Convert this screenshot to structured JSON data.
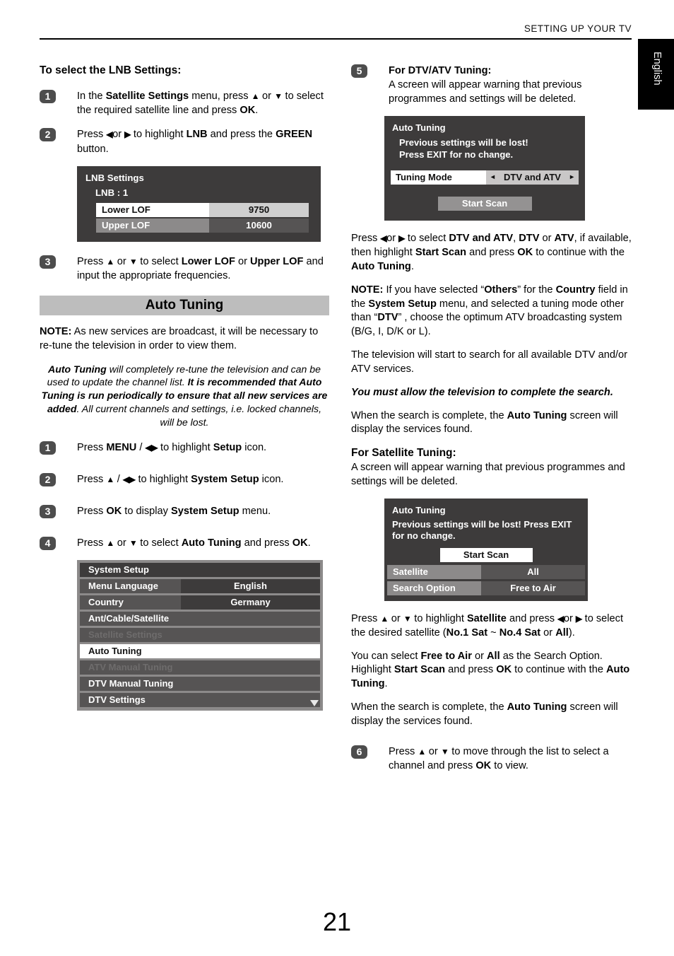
{
  "header": {
    "title": "SETTING UP YOUR TV",
    "language_tab": "English"
  },
  "page_number": "21",
  "left_column": {
    "heading": "To select the LNB Settings:",
    "steps": [
      {
        "number": "1",
        "text_html": "In the <b>Satellite Settings</b> menu, press <b class=\"arrow\">▲</b> or <b class=\"arrow\">▼</b> to select the required satellite line and press <b>OK</b>."
      },
      {
        "number": "2",
        "text_html": "Press <b class=\"arrow\">◀</b>or <b class=\"arrow\">▶</b> to highlight <b>LNB</b> and press the <b>GREEN</b> button."
      },
      {
        "number": "3",
        "text_html": "Press <b class=\"arrow\">▲</b> or <b class=\"arrow\">▼</b> to select <b>Lower LOF</b> or <b>Upper LOF</b> and input the appropriate frequencies."
      }
    ],
    "lnb_osd": {
      "title": "LNB Settings",
      "subtitle": "LNB : 1",
      "rows": [
        {
          "label": "Lower LOF",
          "value": "9750",
          "state": "selected"
        },
        {
          "label": "Upper LOF",
          "value": "10600",
          "state": "normal"
        }
      ]
    },
    "section_banner": "Auto Tuning",
    "note_html": "<b>NOTE:</b> As new services are broadcast, it will be necessary to re-tune the television in order to view them.",
    "italic_note_html": "<span class=\"i-strong\">Auto Tuning</span> <span class=\"i-norm\">will completely re-tune the television and can be used to update the channel list.</span> <span class=\"i-strong\">It is recommended that Auto Tuning is run periodically to ensure that all new services are added</span><span class=\"i-norm\">. All current channels and settings, i.e. locked channels, will be lost.</span>",
    "auto_tuning_steps": [
      {
        "number": "1",
        "text_html": "Press <b>MENU</b> / <b class=\"arrow\">◀▶</b> to highlight <b>Setup</b> icon."
      },
      {
        "number": "2",
        "text_html": "Press <b class=\"arrow\">▲</b> / <b class=\"arrow\">◀▶</b> to highlight <b>System Setup</b> icon."
      },
      {
        "number": "3",
        "text_html": "Press <b>OK</b> to display <b>System Setup</b> menu."
      },
      {
        "number": "4",
        "text_html": "Press <b class=\"arrow\">▲</b> or <b class=\"arrow\">▼</b> to select <b>Auto Tuning</b> and press <b>OK</b>."
      }
    ],
    "system_setup_osd": {
      "title": "System Setup",
      "scroll_down_icon": "chevron-down-icon",
      "rows": [
        {
          "label": "Menu Language",
          "value": "English",
          "state": "normal"
        },
        {
          "label": "Country",
          "value": "Germany",
          "state": "normal"
        },
        {
          "label": "Ant/Cable/Satellite",
          "value": "",
          "state": "normal"
        },
        {
          "label": "Satellite Settings",
          "value": "",
          "state": "disabled"
        },
        {
          "label": "Auto Tuning",
          "value": "",
          "state": "active"
        },
        {
          "label": "ATV Manual Tuning",
          "value": "",
          "state": "disabled"
        },
        {
          "label": "DTV Manual Tuning",
          "value": "",
          "state": "normal"
        },
        {
          "label": "DTV Settings",
          "value": "",
          "state": "normal"
        }
      ]
    }
  },
  "right_column": {
    "step5": {
      "number": "5",
      "heading": "For DTV/ATV Tuning:",
      "text": "A screen will appear warning that previous programmes and settings will be deleted."
    },
    "dtv_osd": {
      "title": "Auto Tuning",
      "message_line1": "Previous settings will be lost!",
      "message_line2": "Press EXIT for no change.",
      "mode_label": "Tuning Mode",
      "mode_value": "DTV and ATV",
      "left_caret": "◂",
      "right_caret": "▸",
      "start_scan": "Start Scan"
    },
    "paragraphs_after_dtv": [
      "Press <b class=\"arrow\">◀</b>or <b class=\"arrow\">▶</b> to select <b>DTV and ATV</b>, <b>DTV</b> or <b>ATV</b>, if available, then highlight <b>Start Scan</b> and press <b>OK</b> to continue with the <b>Auto Tuning</b>.",
      "<b>NOTE:</b> If you have selected “<b>Others</b>” for the <b>Country</b> field in the <b>System Setup</b> menu, and selected a tuning mode other than “<b>DTV</b>” , choose the optimum ATV broadcasting system (B/G, I, D/K or L).",
      "The television will start to search for all available DTV and/or ATV services."
    ],
    "italic_warning": "You must allow the television to complete the search.",
    "search_complete_1": "When the search is complete, the <b>Auto Tuning</b> screen will display the services found.",
    "satellite_heading": "For Satellite Tuning:",
    "satellite_intro": "A screen will appear warning that previous programmes and settings will be deleted.",
    "sat_osd": {
      "title": "Auto Tuning",
      "message": "Previous settings will be lost! Press EXIT for no change.",
      "start_scan": "Start Scan",
      "rows": [
        {
          "label": "Satellite",
          "value": "All"
        },
        {
          "label": "Search Option",
          "value": "Free to Air"
        }
      ]
    },
    "paragraphs_after_sat": [
      "Press <b class=\"arrow\">▲</b> or <b class=\"arrow\">▼</b> to highlight <b>Satellite</b> and press <b class=\"arrow\">◀</b>or <b class=\"arrow\">▶</b> to select the desired satellite (<b>No.1 Sat</b> ~ <b>No.4 Sat</b> or <b>All</b>).",
      "You can select <b>Free to Air</b> or <b>All</b> as the Search Option. Highlight <b>Start Scan</b> and press <b>OK</b> to continue with the <b>Auto Tuning</b>.",
      "When the search is complete, the <b>Auto Tuning</b> screen will display the services found."
    ],
    "step6": {
      "number": "6",
      "text_html": "Press <b class=\"arrow\">▲</b> or <b class=\"arrow\">▼</b> to move through the list to select a channel and press <b>OK</b> to view."
    }
  }
}
